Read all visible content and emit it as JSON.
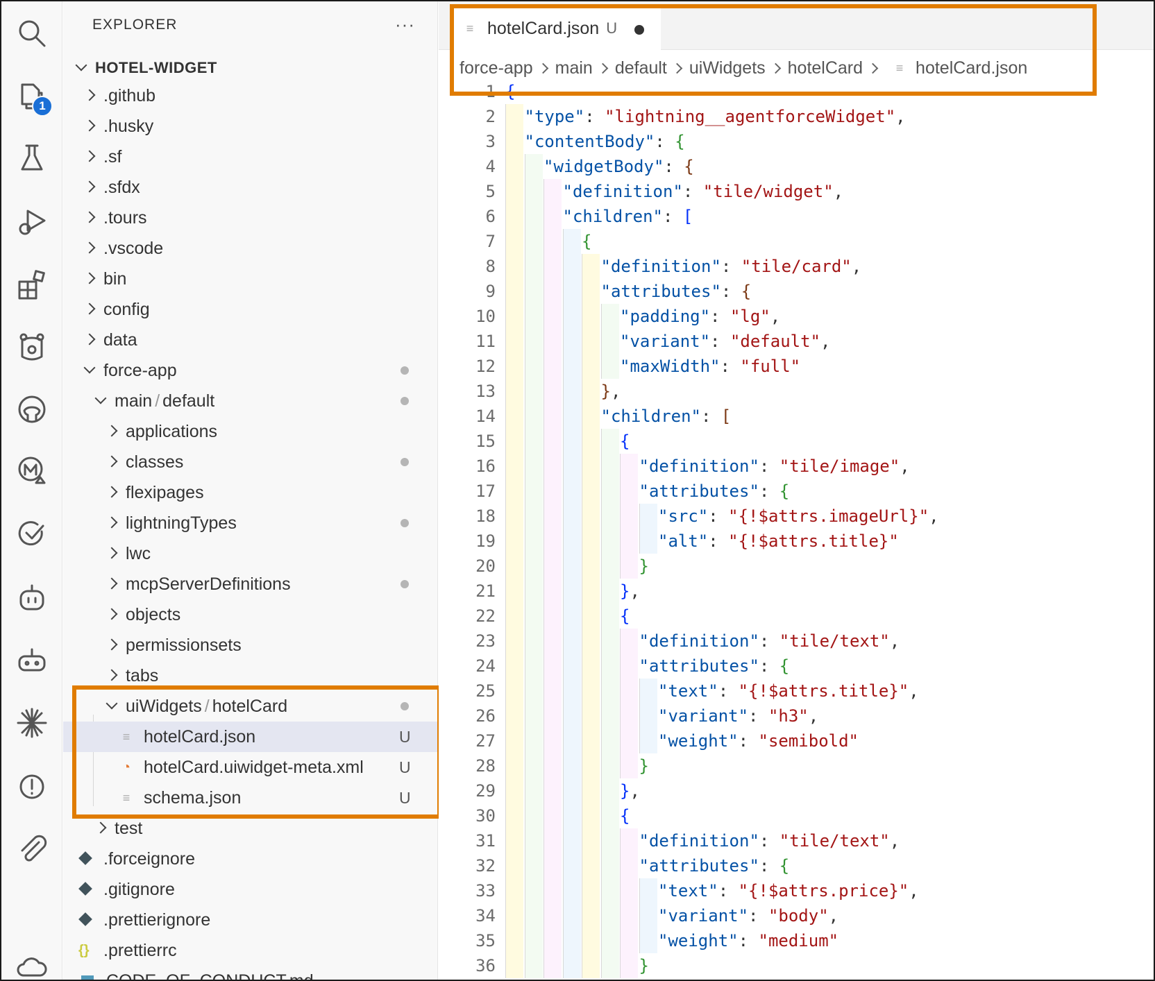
{
  "activity_bar": {
    "icons": [
      "search-icon",
      "explorer-icon",
      "testing-icon",
      "run-debug-icon",
      "extensions-icon",
      "bear-icon",
      "github-icon",
      "mulesoft-icon",
      "check-circle-icon",
      "agent-icon",
      "robot-icon",
      "asterisk-icon",
      "alert-icon",
      "paperclip-icon",
      "cloud-icon"
    ],
    "explorer_badge": "1"
  },
  "sidebar": {
    "header": "EXPLORER",
    "more": "···",
    "root": "HOTEL-WIDGET",
    "items": [
      {
        "label": ".github"
      },
      {
        "label": ".husky"
      },
      {
        "label": ".sf"
      },
      {
        "label": ".sfdx"
      },
      {
        "label": ".tours"
      },
      {
        "label": ".vscode"
      },
      {
        "label": "bin"
      },
      {
        "label": "config"
      },
      {
        "label": "data"
      },
      {
        "label": "force-app"
      },
      {
        "label_a": "main",
        "label_b": "default",
        "sep": "/"
      },
      {
        "label": "applications"
      },
      {
        "label": "classes"
      },
      {
        "label": "flexipages"
      },
      {
        "label": "lightningTypes"
      },
      {
        "label": "lwc"
      },
      {
        "label": "mcpServerDefinitions"
      },
      {
        "label": "objects"
      },
      {
        "label": "permissionsets"
      },
      {
        "label": "tabs"
      },
      {
        "label_a": "uiWidgets",
        "label_b": "hotelCard",
        "sep": "/"
      },
      {
        "label": "hotelCard.json",
        "status": "U"
      },
      {
        "label": "hotelCard.uiwidget-meta.xml",
        "status": "U"
      },
      {
        "label": "schema.json",
        "status": "U"
      },
      {
        "label": "test"
      },
      {
        "label": ".forceignore"
      },
      {
        "label": ".gitignore"
      },
      {
        "label": ".prettierignore"
      },
      {
        "label": ".prettierrc"
      },
      {
        "label": "CODE_OF_CONDUCT.md"
      }
    ]
  },
  "editor": {
    "tab": {
      "label": "hotelCard.json",
      "status": "U"
    },
    "breadcrumb": [
      "force-app",
      "main",
      "default",
      "uiWidgets",
      "hotelCard",
      "hotelCard.json"
    ],
    "line_numbers": [
      "1",
      "2",
      "3",
      "4",
      "5",
      "6",
      "7",
      "8",
      "9",
      "10",
      "11",
      "12",
      "13",
      "14",
      "15",
      "16",
      "17",
      "18",
      "19",
      "20",
      "21",
      "22",
      "23",
      "24",
      "25",
      "26",
      "27",
      "28",
      "29",
      "30",
      "31",
      "32",
      "33",
      "34",
      "35",
      "36"
    ],
    "lines": [
      "{",
      "\"type\": \"lightning__agentforceWidget\",",
      "\"contentBody\": {",
      "\"widgetBody\": {",
      "\"definition\": \"tile/widget\",",
      "\"children\": [",
      "{",
      "\"definition\": \"tile/card\",",
      "\"attributes\": {",
      "\"padding\": \"lg\",",
      "\"variant\": \"default\",",
      "\"maxWidth\": \"full\"",
      "},",
      "\"children\": [",
      "{",
      "\"definition\": \"tile/image\",",
      "\"attributes\": {",
      "\"src\": \"{!$attrs.imageUrl}\",",
      "\"alt\": \"{!$attrs.title}\"",
      "}",
      "},",
      "{",
      "\"definition\": \"tile/text\",",
      "\"attributes\": {",
      "\"text\": \"{!$attrs.title}\",",
      "\"variant\": \"h3\",",
      "\"weight\": \"semibold\"",
      "}",
      "},",
      "{",
      "\"definition\": \"tile/text\",",
      "\"attributes\": {",
      "\"text\": \"{!$attrs.price}\",",
      "\"variant\": \"body\",",
      "\"weight\": \"medium\"",
      "}"
    ]
  },
  "colors": {
    "highlight": "#e07c00",
    "json_key": "#0451a5",
    "json_string": "#a31515",
    "badge": "#1a6fd6"
  }
}
